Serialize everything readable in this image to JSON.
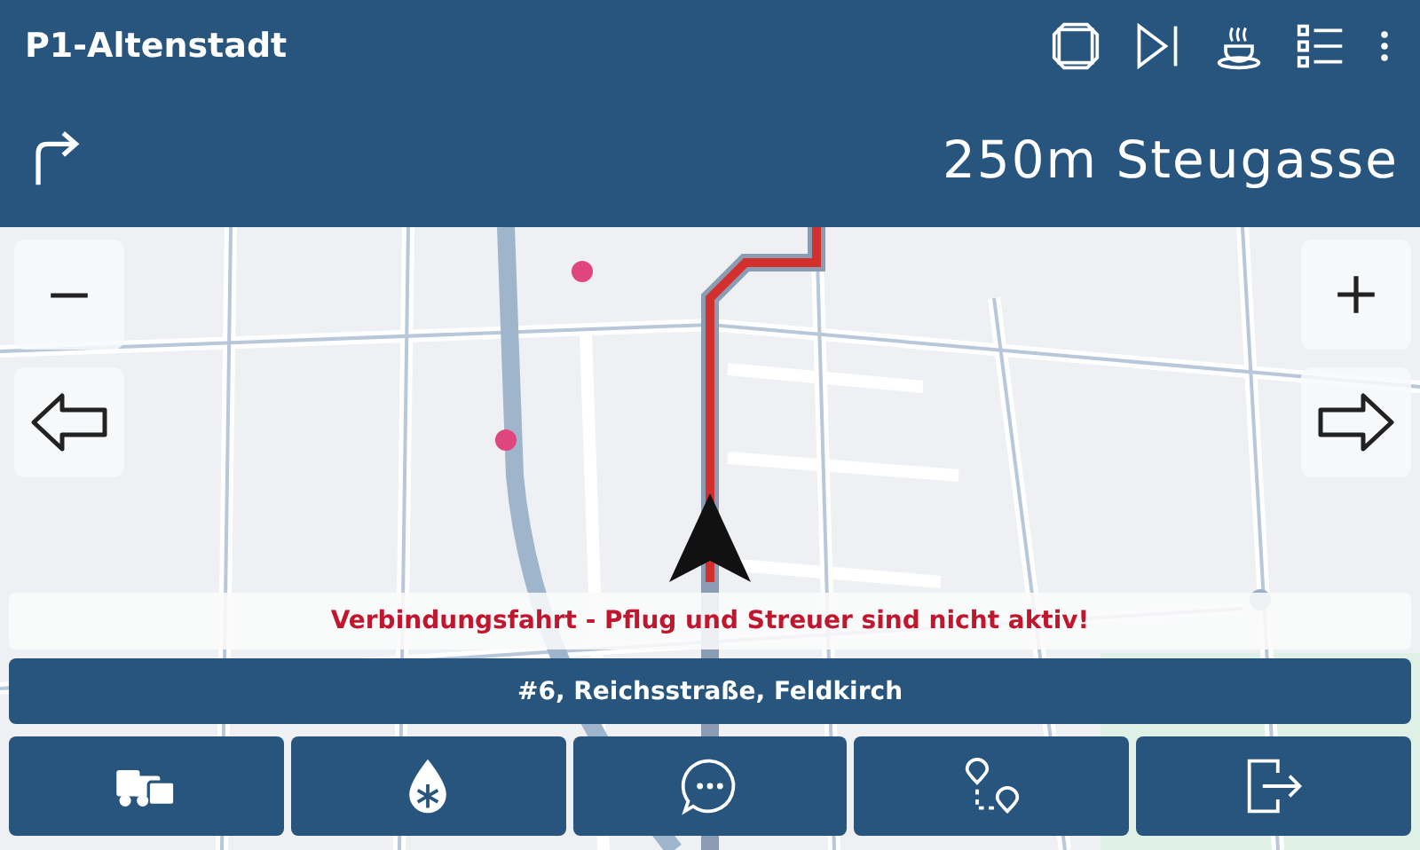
{
  "header": {
    "title": "P1-Altenstadt"
  },
  "instruction": {
    "text": "250m Steugasse"
  },
  "map": {
    "notice": "Verbindungsfahrt - Pflug und Streuer sind nicht aktiv!",
    "destination": "#6, Reichsstraße, Feldkirch"
  }
}
